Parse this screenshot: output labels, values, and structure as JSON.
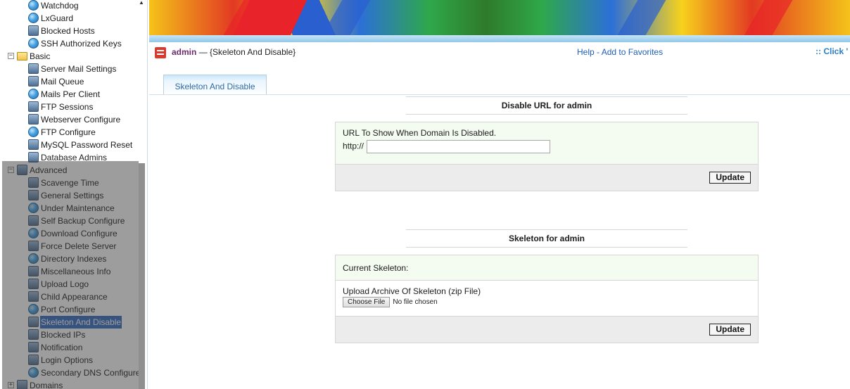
{
  "sidebar": {
    "items": [
      {
        "label": "Watchdog",
        "icon": "globe-icon"
      },
      {
        "label": "LxGuard",
        "icon": "globe-icon"
      },
      {
        "label": "Blocked Hosts",
        "icon": "blocked-hosts-icon"
      },
      {
        "label": "SSH Authorized Keys",
        "icon": "globe-icon"
      },
      {
        "label": "Basic",
        "icon": "folder-icon",
        "group": true
      },
      {
        "label": "Server Mail Settings",
        "icon": "mail-settings-icon"
      },
      {
        "label": "Mail Queue",
        "icon": "mail-queue-icon"
      },
      {
        "label": "Mails Per Client",
        "icon": "globe-icon"
      },
      {
        "label": "FTP Sessions",
        "icon": "ftp-sessions-icon"
      },
      {
        "label": "Webserver Configure",
        "icon": "webserver-icon"
      },
      {
        "label": "FTP Configure",
        "icon": "globe-icon"
      },
      {
        "label": "MySQL Password Reset",
        "icon": "mysql-icon"
      },
      {
        "label": "Database Admins",
        "icon": "database-icon"
      },
      {
        "label": "Advanced",
        "icon": "advanced-icon",
        "group": true
      },
      {
        "label": "Scavenge Time",
        "icon": "clock-icon"
      },
      {
        "label": "General Settings",
        "icon": "gear-icon"
      },
      {
        "label": "Under Maintenance",
        "icon": "globe-icon"
      },
      {
        "label": "Self Backup Configure",
        "icon": "backup-icon"
      },
      {
        "label": "Download Configure",
        "icon": "globe-icon"
      },
      {
        "label": "Force Delete Server",
        "icon": "delete-server-icon"
      },
      {
        "label": "Directory Indexes",
        "icon": "globe-icon"
      },
      {
        "label": "Miscellaneous Info",
        "icon": "info-icon"
      },
      {
        "label": "Upload Logo",
        "icon": "upload-icon"
      },
      {
        "label": "Child Appearance",
        "icon": "appearance-icon"
      },
      {
        "label": "Port Configure",
        "icon": "globe-icon"
      },
      {
        "label": "Skeleton And Disable",
        "icon": "skeleton-icon",
        "selected": true
      },
      {
        "label": "Blocked IPs",
        "icon": "blocked-ips-icon"
      },
      {
        "label": "Notification",
        "icon": "notification-icon"
      },
      {
        "label": "Login Options",
        "icon": "login-icon"
      },
      {
        "label": "Secondary DNS Configure",
        "icon": "globe-icon"
      },
      {
        "label": "Domains",
        "icon": "domains-icon",
        "group": true
      }
    ]
  },
  "header": {
    "user": "admin",
    "dash": "—",
    "page": "{Skeleton And Disable}",
    "help": "Help",
    "sep": " - ",
    "favorites": "Add to Favorites",
    "click": ":: Click '"
  },
  "tab": {
    "label": "Skeleton And Disable"
  },
  "disable_section": {
    "title": "Disable URL for admin",
    "field_label": "URL To Show When Domain Is Disabled.",
    "prefix": "http://",
    "url_value": "",
    "update_label": "Update"
  },
  "skeleton_section": {
    "title": "Skeleton for admin",
    "current_label": "Current Skeleton:",
    "upload_label": "Upload Archive Of Skeleton (zip File)",
    "choose_label": "Choose File",
    "no_file": "No file chosen",
    "update_label": "Update"
  },
  "colors": {
    "accent": "#1f5fb5",
    "selection": "#316ac5",
    "banner_bar": "#8fc7ea"
  }
}
